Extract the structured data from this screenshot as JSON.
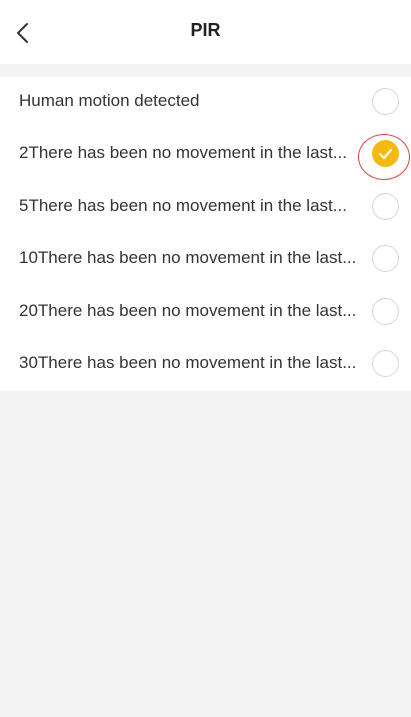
{
  "header": {
    "title": "PIR",
    "back_icon": "chevron-left-icon"
  },
  "options": [
    {
      "label": "Human motion detected",
      "selected": false
    },
    {
      "label": "2There has been no movement in the last...",
      "selected": true
    },
    {
      "label": "5There has been no movement in the last...",
      "selected": false
    },
    {
      "label": "10There has been no movement in the last...",
      "selected": false
    },
    {
      "label": "20There has been no movement in the last...",
      "selected": false
    },
    {
      "label": "30There has been no movement in the last...",
      "selected": false
    }
  ],
  "colors": {
    "selected_accent": "#f6b910",
    "annotation_ring": "#d9453b"
  }
}
